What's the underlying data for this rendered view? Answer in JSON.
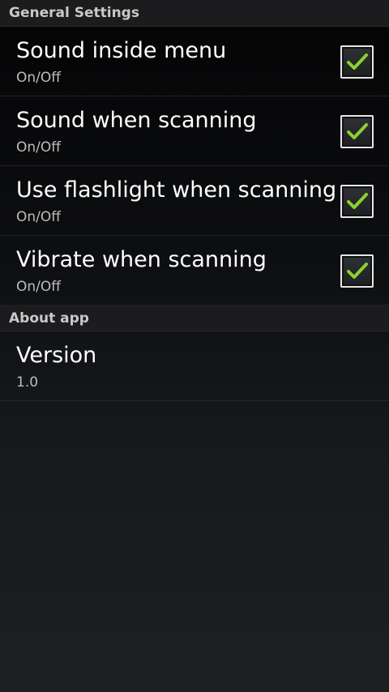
{
  "general": {
    "header": "General Settings",
    "items": [
      {
        "title": "Sound inside menu",
        "summary": "On/Off",
        "checked": true
      },
      {
        "title": "Sound when scanning",
        "summary": "On/Off",
        "checked": true
      },
      {
        "title": "Use flashlight when scanning",
        "summary": "On/Off",
        "checked": true
      },
      {
        "title": "Vibrate when scanning",
        "summary": "On/Off",
        "checked": true
      }
    ]
  },
  "about": {
    "header": "About app",
    "version_title": "Version",
    "version_value": "1.0"
  },
  "colors": {
    "check_green": "#8bd12f",
    "header_bg": "#1c1c1e"
  },
  "icons": {
    "checkbox": "checkmark-icon"
  }
}
